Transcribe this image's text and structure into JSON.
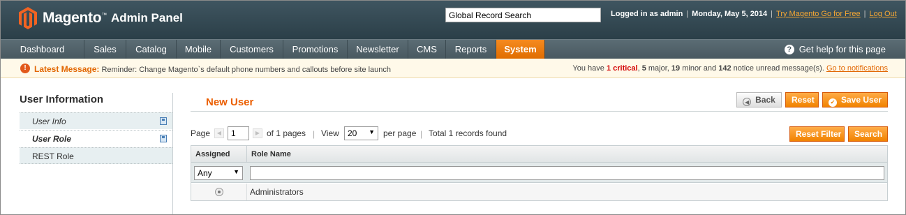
{
  "header": {
    "logo_name": "Magento",
    "logo_tm": "™",
    "logo_sub": "Admin Panel",
    "search_value": "Global Record Search",
    "logged_in": "Logged in as admin",
    "date": "Monday, May 5, 2014",
    "try_link": "Try Magento Go for Free",
    "logout": "Log Out",
    "separator": "|"
  },
  "nav": {
    "items": [
      {
        "label": "Dashboard"
      },
      {
        "label": "Sales"
      },
      {
        "label": "Catalog"
      },
      {
        "label": "Mobile"
      },
      {
        "label": "Customers"
      },
      {
        "label": "Promotions"
      },
      {
        "label": "Newsletter"
      },
      {
        "label": "CMS"
      },
      {
        "label": "Reports"
      },
      {
        "label": "System"
      }
    ],
    "active": "System",
    "help": "Get help for this page",
    "help_glyph": "?"
  },
  "message": {
    "icon_glyph": "!",
    "label": "Latest Message:",
    "text": "Reminder: Change Magento`s default phone numbers and callouts before site launch",
    "you_have": "You have",
    "critical_count": "1 critical",
    "major": "5",
    "major_label": "major,",
    "minor": "19",
    "minor_label": "minor and",
    "notice": "142",
    "notice_label": "notice unread message(s).",
    "link": "Go to notifications"
  },
  "sidebar": {
    "title": "User Information",
    "items": [
      {
        "label": "User Info"
      },
      {
        "label": "User Role"
      },
      {
        "label": "REST Role"
      }
    ]
  },
  "main": {
    "title": "New User",
    "buttons": {
      "back": "Back",
      "reset": "Reset",
      "save": "Save User",
      "reset_filter": "Reset Filter",
      "search": "Search"
    },
    "pager": {
      "page_label": "Page",
      "page_value": "1",
      "of_pages": "of 1 pages",
      "view_label": "View",
      "per_page_value": "20",
      "per_page_label": "per page",
      "total": "Total 1 records found",
      "sep": "|",
      "prev_glyph": "◀",
      "next_glyph": "▶"
    },
    "grid": {
      "columns": [
        "Assigned",
        "Role Name"
      ],
      "filter_assigned": "Any",
      "rows": [
        {
          "assigned": true,
          "role_name": "Administrators"
        }
      ]
    }
  },
  "colors": {
    "header_bg": "#2b3f48",
    "nav_active": "#f18200",
    "accent": "#eb5e00",
    "link": "#f6a733"
  }
}
